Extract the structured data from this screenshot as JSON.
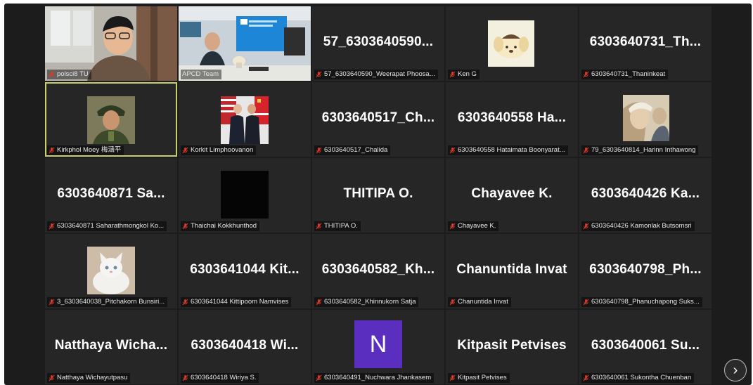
{
  "participants": [
    {
      "id": "p1",
      "label": "polsci8 TU",
      "muted": true,
      "display": "video"
    },
    {
      "id": "p2",
      "label": "APCD Team",
      "muted": false,
      "display": "video"
    },
    {
      "id": "p3",
      "label": "57_6303640590_Weerapat Phoosa...",
      "big": "57_6303640590...",
      "muted": true,
      "display": "name"
    },
    {
      "id": "p4",
      "label": "Ken G",
      "muted": true,
      "display": "avatar"
    },
    {
      "id": "p5",
      "label": "6303640731_Thaninkeat",
      "big": "6303640731_Th...",
      "muted": true,
      "display": "name"
    },
    {
      "id": "p6",
      "label": "Kirkphol Moey 梅涵平",
      "muted": true,
      "display": "avatar",
      "active": true
    },
    {
      "id": "p7",
      "label": "Korkit Limphoovanon",
      "muted": true,
      "display": "avatar"
    },
    {
      "id": "p8",
      "label": "6303640517_Chalida",
      "big": "6303640517_Ch...",
      "muted": true,
      "display": "name"
    },
    {
      "id": "p9",
      "label": "6303640558 Hataimata Boonyarat...",
      "big": "6303640558  Ha...",
      "muted": true,
      "display": "name"
    },
    {
      "id": "p10",
      "label": "79_6303640814_Harinn Inthawong",
      "muted": true,
      "display": "avatar"
    },
    {
      "id": "p11",
      "label": "6303640871 Saharathmongkol Ko...",
      "big": "6303640871  Sa...",
      "muted": true,
      "display": "name"
    },
    {
      "id": "p12",
      "label": "Thaichai Kokkhunthod",
      "muted": true,
      "display": "avatar"
    },
    {
      "id": "p13",
      "label": "THITIPA O.",
      "big": "THITIPA O.",
      "muted": true,
      "display": "name"
    },
    {
      "id": "p14",
      "label": "Chayavee K.",
      "big": "Chayavee K.",
      "muted": true,
      "display": "name"
    },
    {
      "id": "p15",
      "label": "6303640426 Kamonlak Butsomsri",
      "big": "6303640426  Ka...",
      "muted": true,
      "display": "name"
    },
    {
      "id": "p16",
      "label": "3_6303640038_Pitchakorn Bunsiri...",
      "muted": true,
      "display": "avatar"
    },
    {
      "id": "p17",
      "label": "6303641044 Kittipoom Namvises",
      "big": "6303641044  Kit...",
      "muted": true,
      "display": "name"
    },
    {
      "id": "p18",
      "label": "6303640582_Khinnukorn Satja",
      "big": "6303640582_Kh...",
      "muted": true,
      "display": "name"
    },
    {
      "id": "p19",
      "label": "Chanuntida Invat",
      "big": "Chanuntida Invat",
      "muted": true,
      "display": "name"
    },
    {
      "id": "p20",
      "label": "6303640798_Phanuchapong Suks...",
      "big": "6303640798_Ph...",
      "muted": true,
      "display": "name"
    },
    {
      "id": "p21",
      "label": "Natthaya Wichayutpasu",
      "big": "Natthaya  Wicha...",
      "muted": true,
      "display": "name"
    },
    {
      "id": "p22",
      "label": "6303640418 Wiriya S.",
      "big": "6303640418  Wi...",
      "muted": true,
      "display": "name"
    },
    {
      "id": "p23",
      "label": "6303640491_Nuchwara Jhankasem",
      "muted": true,
      "display": "initial",
      "initial": "N"
    },
    {
      "id": "p24",
      "label": "Kitpasit Petvises",
      "big": "Kitpasit Petvises",
      "muted": true,
      "display": "name"
    },
    {
      "id": "p25",
      "label": "6303640061 Sukontha Chuenban",
      "big": "6303640061  Su...",
      "muted": true,
      "display": "name"
    }
  ],
  "controls": {
    "next_page_icon": "chevron-right-icon",
    "next_page_glyph": "›"
  },
  "colors": {
    "tile_bg": "#262626",
    "screen_bg": "#1c1c1c",
    "muted_mic": "#e0392b",
    "active_border": "#c9cf6a",
    "initial_avatar": "#5a2fbf"
  }
}
